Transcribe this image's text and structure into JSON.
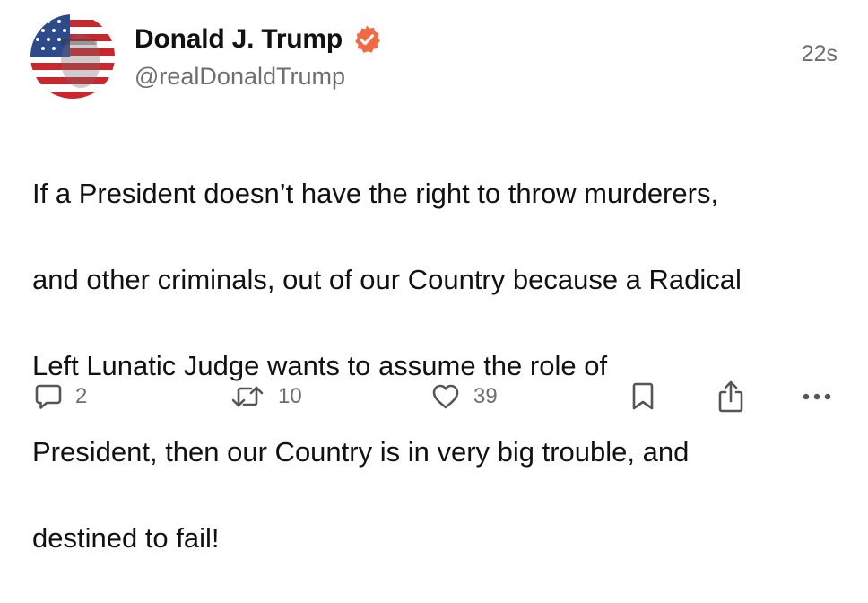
{
  "post": {
    "display_name": "Donald J. Trump",
    "handle": "@realDonaldTrump",
    "timestamp": "22s",
    "verified": true,
    "body_lines": [
      "If a President doesn’t have the right to throw murderers,",
      "and other criminals, out of our Country because a Radical",
      "Left Lunatic Judge wants to assume the role of",
      "President, then our Country is in very big trouble, and",
      "destined to fail!"
    ],
    "actions": {
      "reply_count": "2",
      "repost_count": "10",
      "like_count": "39"
    }
  },
  "colors": {
    "verified_badge": "#f06a45",
    "text_primary": "#111111",
    "text_secondary": "#6e6e6e",
    "icon": "#555555"
  },
  "icons": {
    "avatar": "flag-face-avatar",
    "verified": "verified-badge-icon",
    "reply": "speech-bubble-icon",
    "repost": "repost-arrows-icon",
    "like": "heart-icon",
    "bookmark": "bookmark-icon",
    "share": "share-icon",
    "more": "more-dots-icon"
  }
}
